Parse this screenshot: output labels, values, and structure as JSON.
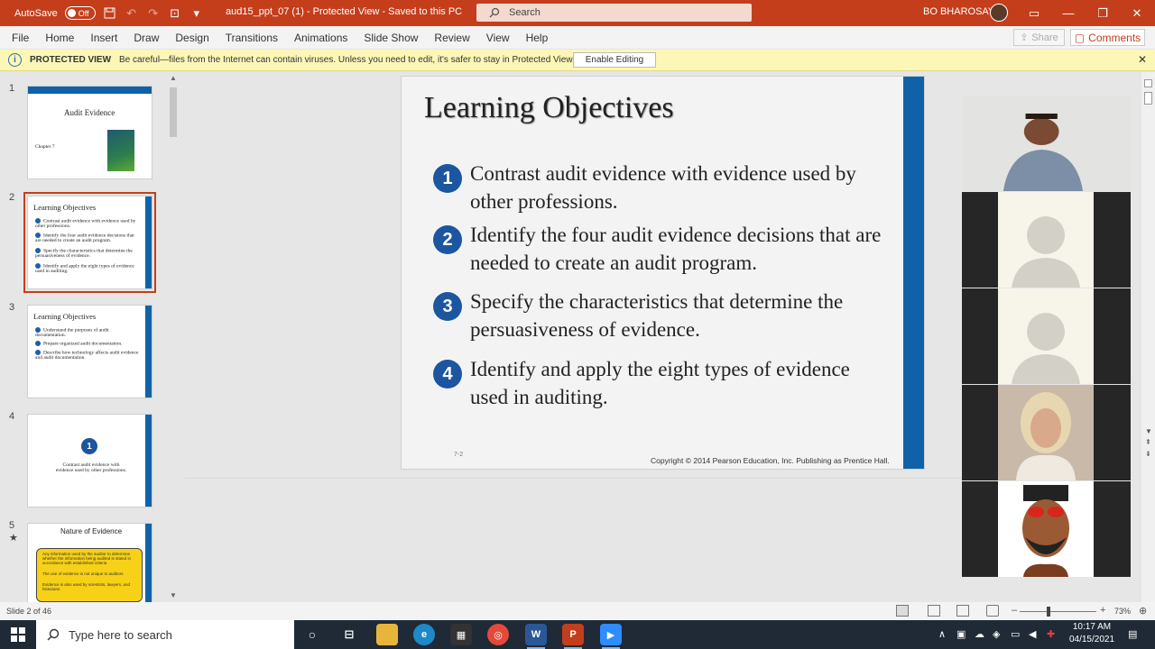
{
  "titlebar": {
    "autosave_label": "AutoSave",
    "autosave_state": "Off",
    "doc_title": "aud15_ppt_07 (1)  -  Protected View  -  Saved to this PC",
    "search_placeholder": "Search",
    "user_name": "BO BHAROSAY"
  },
  "menu": [
    "File",
    "Home",
    "Insert",
    "Draw",
    "Design",
    "Transitions",
    "Animations",
    "Slide Show",
    "Review",
    "View",
    "Help"
  ],
  "share_label": "Share",
  "comments_label": "Comments",
  "protected": {
    "title": "PROTECTED VIEW",
    "message": "Be careful—files from the Internet can contain viruses. Unless you need to edit, it's safer to stay in Protected View.",
    "enable_label": "Enable Editing"
  },
  "thumbnails": {
    "numbers": [
      "1",
      "2",
      "3",
      "4",
      "5"
    ],
    "t1": {
      "title": "Audit Evidence",
      "sub": "Chapter 7"
    },
    "t2": {
      "title": "Learning Objectives",
      "lines": [
        "Contrast audit evidence with evidence used by other professions.",
        "Identify the four audit evidence decisions that are needed to create an audit program.",
        "Specify the characteristics that determine the persuasiveness of evidence.",
        "Identify and apply the eight types of evidence used in auditing."
      ]
    },
    "t3": {
      "title": "Learning Objectives",
      "lines": [
        "Understand the purposes of audit documentation.",
        "Prepare organized audit documentation.",
        "Describe how technology affects audit evidence and audit documentation."
      ]
    },
    "t4": {
      "num": "1",
      "text": "Contrast audit evidence with evidence used by other professions."
    },
    "t5": {
      "title": "Nature of Evidence",
      "lines": [
        "Any information used by the auditor to determine whether the information being audited is stated in accordance with established criteria",
        "The use of evidence is not unique to auditors",
        "Evidence is also used by scientists, lawyers, and historians"
      ]
    }
  },
  "slide": {
    "title": "Learning Objectives",
    "objectives": [
      {
        "num": "1",
        "text": "Contrast audit evidence with evidence used by other professions."
      },
      {
        "num": "2",
        "text": "Identify the four audit evidence decisions that are needed to create an audit program."
      },
      {
        "num": "3",
        "text": "Specify the characteristics that determine the persuasiveness of evidence."
      },
      {
        "num": "4",
        "text": "Identify and apply the eight types of evidence used in auditing."
      }
    ],
    "slide_number": "7-2",
    "copyright": "Copyright © 2014 Pearson Education, Inc. Publishing as Prentice Hall."
  },
  "status": {
    "slide_count": "Slide 2 of 46",
    "zoom": "73%"
  },
  "taskbar": {
    "search_placeholder": "Type here to search",
    "time": "10:17 AM",
    "date": "04/15/2021"
  },
  "colors": {
    "accent": "#c43e1c",
    "slide_stripe": "#0f62a8",
    "number_badge": "#1c55a0",
    "protected_bar": "#fcf7b6"
  }
}
